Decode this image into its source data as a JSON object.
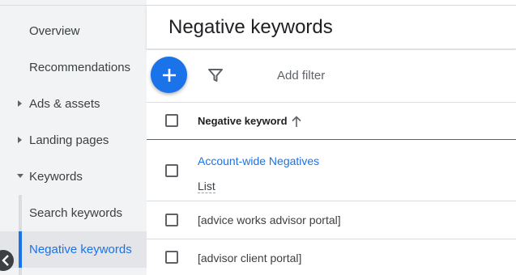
{
  "sidebar": {
    "items": [
      {
        "label": "Overview"
      },
      {
        "label": "Recommendations"
      },
      {
        "label": "Ads & assets"
      },
      {
        "label": "Landing pages"
      },
      {
        "label": "Keywords"
      },
      {
        "label": "Search keywords"
      },
      {
        "label": "Negative keywords"
      }
    ]
  },
  "header": {
    "title": "Negative keywords"
  },
  "toolbar": {
    "add_filter_label": "Add filter"
  },
  "table": {
    "column_header": "Negative keyword",
    "rows": [
      {
        "name": "Account-wide Negatives",
        "type": "List"
      },
      {
        "name": "[advice works advisor portal]"
      },
      {
        "name": "[advisor client portal]"
      }
    ]
  },
  "colors": {
    "accent": "#1a73e8",
    "sidebar_bg": "#f1f3f4",
    "text": "#3c4043"
  }
}
